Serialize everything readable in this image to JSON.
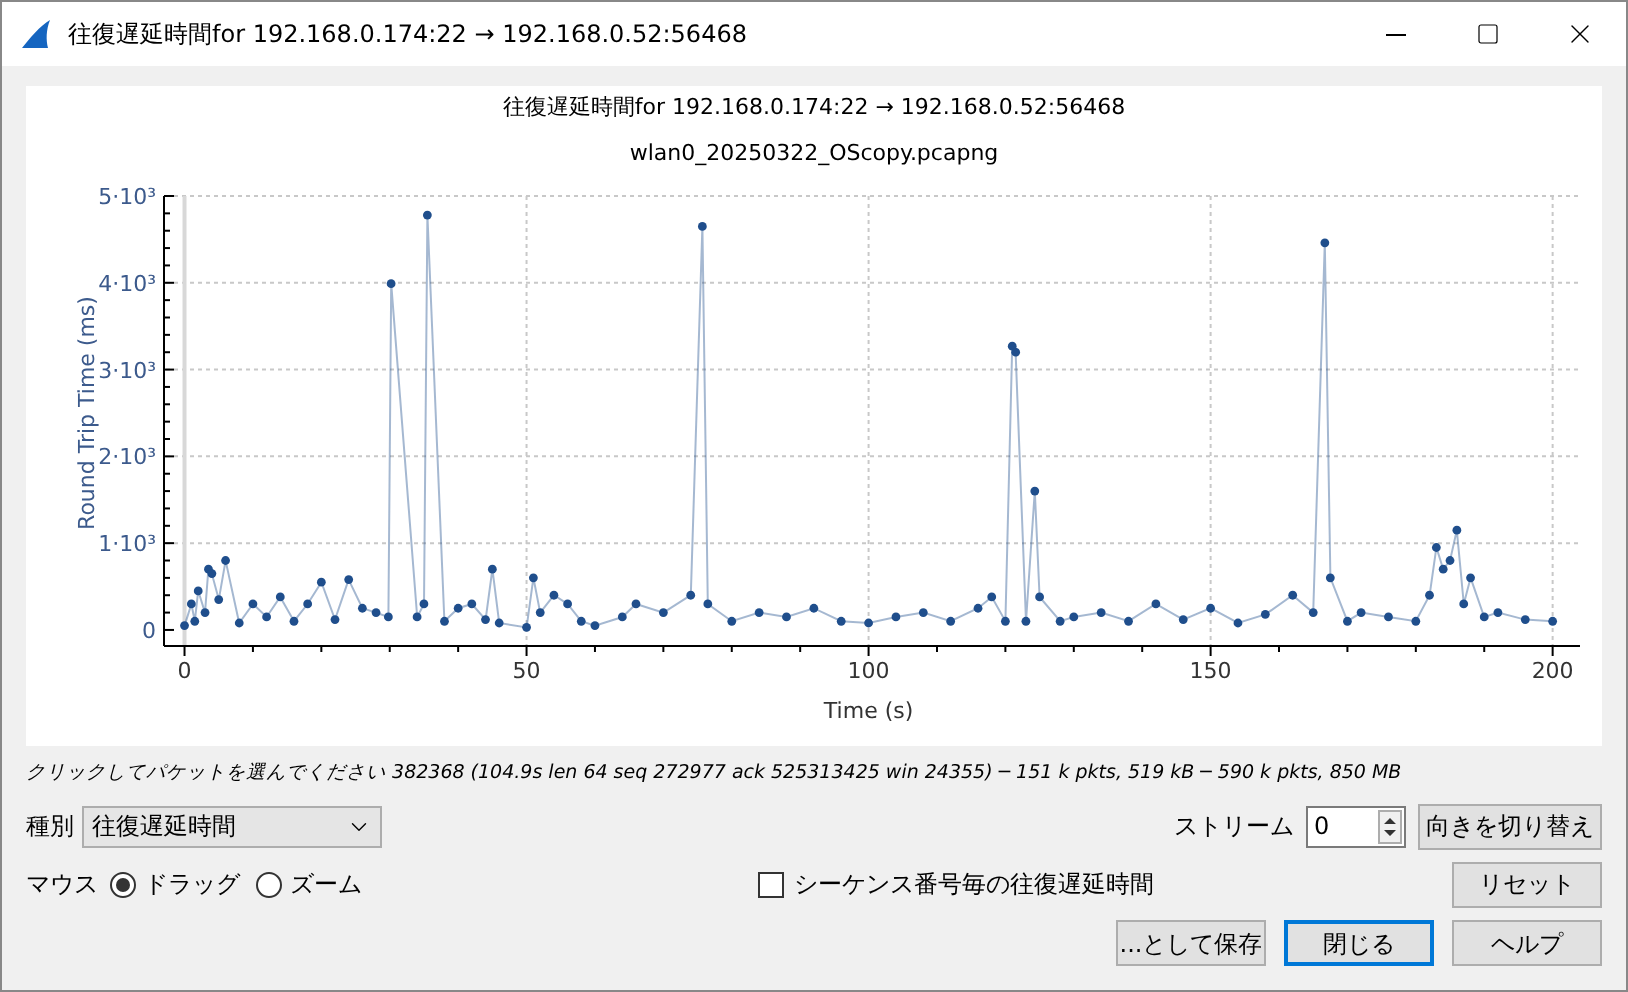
{
  "window": {
    "title": "往復遅延時間for 192.168.0.174:22 → 192.168.0.52:56468"
  },
  "plot": {
    "title": "往復遅延時間for 192.168.0.174:22 → 192.168.0.52:56468",
    "subtitle": "wlan0_20250322_OScopy.pcapng",
    "chart_data": {
      "type": "line",
      "xlabel": "Time (s)",
      "ylabel": "Round Trip Time (ms)",
      "xlim": [
        -3,
        204
      ],
      "ylim": [
        -185,
        5000
      ],
      "grid": true,
      "xticks": [
        0,
        50,
        100,
        150,
        200
      ],
      "yticks": [
        {
          "value": 0,
          "label": "0"
        },
        {
          "value": 1000,
          "label": "1·10³"
        },
        {
          "value": 2000,
          "label": "2·10³"
        },
        {
          "value": 3000,
          "label": "3·10³"
        },
        {
          "value": 4000,
          "label": "4·10³"
        },
        {
          "value": 5000,
          "label": "5·10³"
        }
      ],
      "x": [
        0,
        1,
        1.5,
        2,
        3,
        3.5,
        4,
        5,
        6,
        8,
        10,
        12,
        14,
        16,
        18,
        20,
        22,
        24,
        26,
        28,
        29.8,
        30.2,
        34,
        35,
        35.5,
        38,
        40,
        42,
        44,
        45,
        46,
        50,
        51,
        52,
        54,
        56,
        58,
        60,
        64,
        66,
        70,
        74,
        75.7,
        76.5,
        80,
        84,
        88,
        92,
        96,
        100,
        104,
        108,
        112,
        116,
        118,
        120,
        121,
        121.5,
        123,
        124.3,
        125,
        128,
        130,
        134,
        138,
        142,
        146,
        150,
        154,
        158,
        162,
        165,
        166.7,
        167.5,
        170,
        172,
        176,
        180,
        182,
        183,
        184,
        185,
        186,
        187,
        188,
        190,
        192,
        196,
        200
      ],
      "series": [
        {
          "color": "#1f4e8c",
          "marker": "circle",
          "values": [
            50,
            300,
            100,
            450,
            200,
            700,
            650,
            350,
            800,
            80,
            300,
            150,
            380,
            100,
            300,
            550,
            120,
            580,
            250,
            200,
            150,
            3990,
            150,
            300,
            4780,
            100,
            250,
            300,
            120,
            700,
            80,
            30,
            600,
            200,
            400,
            300,
            100,
            50,
            150,
            300,
            200,
            400,
            4650,
            300,
            100,
            200,
            150,
            250,
            100,
            80,
            150,
            200,
            100,
            250,
            380,
            100,
            3270,
            3200,
            100,
            1600,
            380,
            100,
            150,
            200,
            100,
            300,
            120,
            250,
            80,
            180,
            400,
            200,
            4460,
            600,
            100,
            200,
            150,
            100,
            400,
            950,
            700,
            800,
            1150,
            300,
            600,
            150,
            200,
            120,
            100
          ]
        }
      ]
    }
  },
  "status": "クリックしてパケットを選んでください 382368 (104.9s len 64 seq 272977 ack 525313425 win 24355) ─ 151 k pkts, 519 kB ─ 590 k pkts, 850 MB",
  "type_label": "種別",
  "type_value": "往復遅延時間",
  "stream_label": "ストリーム",
  "stream_value": "0",
  "switch_button": "向きを切り替え",
  "mouse_label": "マウス",
  "mouse_modes": [
    {
      "label": "ドラッグ",
      "selected": true
    },
    {
      "label": "ズーム",
      "selected": false
    }
  ],
  "seq_checkbox": {
    "label": "シーケンス番号毎の往復遅延時間",
    "checked": false
  },
  "reset_button": "リセット",
  "buttons": [
    {
      "label": "...として保存",
      "default": false
    },
    {
      "label": "閉じる",
      "default": true
    },
    {
      "label": "ヘルプ",
      "default": false
    }
  ]
}
